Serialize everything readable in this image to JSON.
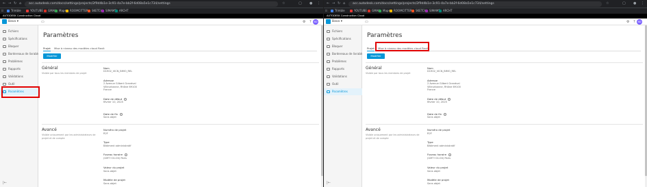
{
  "browser": {
    "url": "acc.autodesk.com/docs/settings/projects/2f9d4b1e-3c91-4a7e-bb2f-6d08a5e1c734/settings",
    "bookmarks": [
      "Trimble",
      "YOUTUBE",
      "GMAIL",
      "Maps",
      "ROOMCITTER",
      "SKETCH",
      "SIMAMS",
      "ARCHT"
    ]
  },
  "brand_bar": "AUTODESK Construction Cloud",
  "topbar": {
    "project": "Bavo",
    "avatar": "BD"
  },
  "sidebar": {
    "items": [
      {
        "label": "Fichiers",
        "icon": "folder-icon"
      },
      {
        "label": "Spécifications",
        "icon": "spec-icon"
      },
      {
        "label": "Bloquer",
        "icon": "block-icon"
      },
      {
        "label": "Bordereaux de livrable...",
        "icon": "list-icon"
      },
      {
        "label": "Problèmes",
        "icon": "issue-icon"
      },
      {
        "label": "Rapports",
        "icon": "report-icon"
      },
      {
        "label": "Validations",
        "icon": "check-icon"
      },
      {
        "label": "Outil",
        "icon": "tool-icon"
      },
      {
        "label": "Paramètres",
        "icon": "gear-icon"
      }
    ],
    "active_index": 8,
    "collapse": "|←"
  },
  "main": {
    "title": "Paramètres",
    "tabs": [
      "Projet",
      "Mise à niveau des modèles cloud Revit"
    ],
    "modify_button": "Modifier",
    "general": {
      "heading": "Général",
      "subtitle": "Visible par tous les membres de projet",
      "fields": [
        {
          "label": "Nom",
          "value": [
            "D1902_VICN_BIMO_REL"
          ]
        },
        {
          "label": "Adresse",
          "value": [
            "2 Avenue Gilbert Grandval",
            "Villeurbanne, Rhône 69100",
            "France"
          ]
        },
        {
          "label": "Date de début",
          "value": [
            "février 10, 2025"
          ]
        },
        {
          "label": "Date de fin",
          "value": [
            "Sans objet"
          ]
        }
      ]
    },
    "advanced": {
      "heading": "Avancé",
      "subtitle": "Visible uniquement par les administrateurs de projet et de compte",
      "fields": [
        {
          "label": "Numéro de projet",
          "value": [
            "R2F"
          ]
        },
        {
          "label": "Type",
          "value": [
            "Bâtiment administratif"
          ]
        },
        {
          "label": "Fuseau horaire",
          "value": [
            "(GMT+01:00) Paris"
          ]
        },
        {
          "label": "Valeur du projet",
          "value": [
            "Sans objet"
          ]
        },
        {
          "label": "Modèle de projet",
          "value": [
            "Sans objet"
          ]
        }
      ]
    }
  },
  "colors": {
    "accent": "#0696d7",
    "highlight": "#e00000"
  }
}
